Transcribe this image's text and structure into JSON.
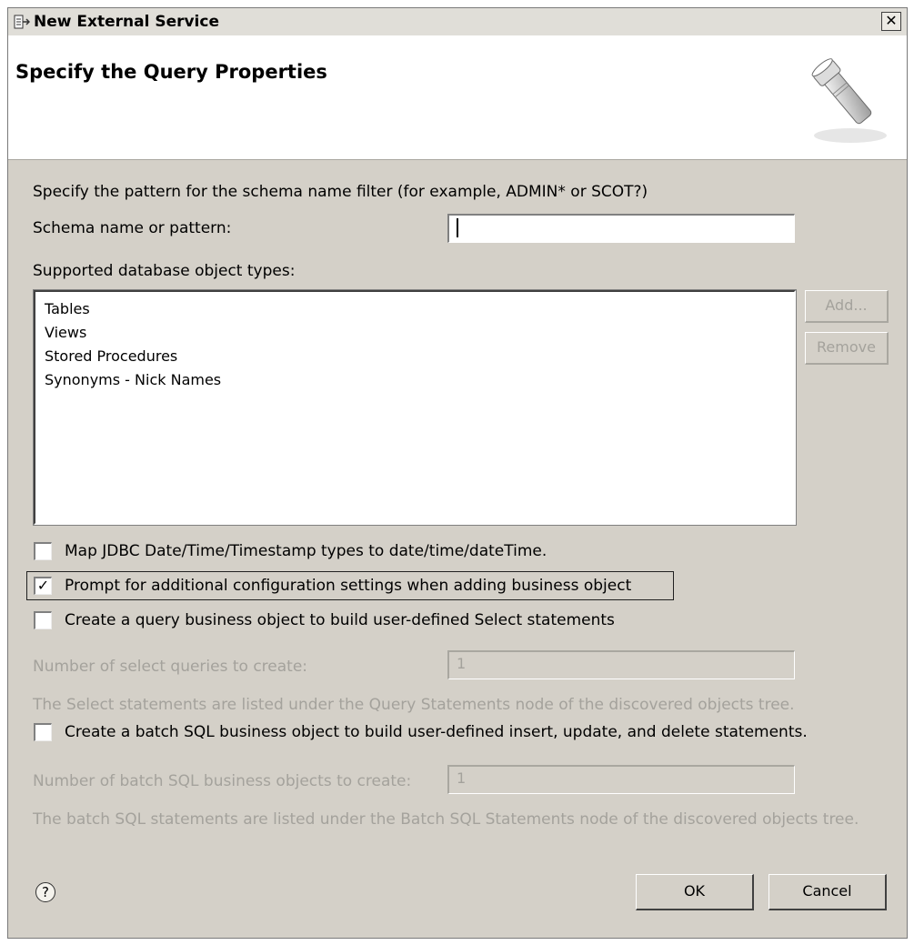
{
  "window": {
    "title": "New External Service",
    "close_glyph": "✕",
    "icon": "wizard-icon"
  },
  "header": {
    "title": "Specify the Query Properties",
    "banner_icon": "flashlight-icon"
  },
  "form": {
    "instruction": "Specify the pattern for the schema name filter (for example, ADMIN* or SCOT?)",
    "schema_label": "Schema name or pattern:",
    "schema_value": "",
    "object_types_label": "Supported database object types:",
    "object_types": [
      "Tables",
      "Views",
      "Stored Procedures",
      "Synonyms - Nick Names"
    ],
    "add_label": "Add...",
    "remove_label": "Remove",
    "map_jdbc_label": "Map JDBC Date/Time/Timestamp types to date/time/dateTime.",
    "map_jdbc_checked": false,
    "prompt_label": "Prompt for additional configuration settings when adding business object",
    "prompt_checked": true,
    "query_bo_label": "Create a query business object to build user-defined Select statements",
    "query_bo_checked": false,
    "num_select_label": "Number of select queries to create:",
    "num_select_value": "1",
    "select_note": "The Select statements are listed under the Query Statements node of the discovered objects tree.",
    "batch_label": "Create a batch SQL business object to build user-defined insert, update, and delete statements.",
    "batch_checked": false,
    "num_batch_label": "Number of batch SQL business objects to create:",
    "num_batch_value": "1",
    "batch_note": "The batch SQL statements are listed under the Batch SQL Statements node of the discovered objects tree."
  },
  "footer": {
    "help_glyph": "?",
    "ok_label": "OK",
    "cancel_label": "Cancel"
  }
}
